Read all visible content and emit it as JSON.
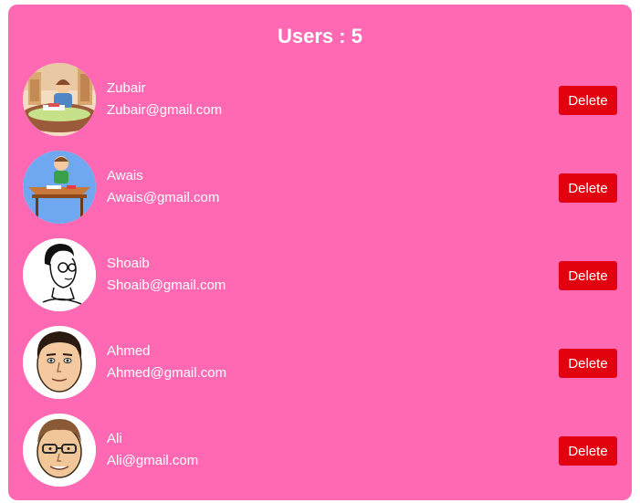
{
  "header": {
    "title": "Users : 5"
  },
  "users": [
    {
      "name": "Zubair",
      "email": "Zubair@gmail.com",
      "avatar_icon": "boy-reading-at-desk-avatar",
      "delete_label": "Delete"
    },
    {
      "name": "Awais",
      "email": "Awais@gmail.com",
      "avatar_icon": "boy-at-school-desk-avatar",
      "delete_label": "Delete"
    },
    {
      "name": "Shoaib",
      "email": "Shoaib@gmail.com",
      "avatar_icon": "sketched-man-with-glasses-avatar",
      "delete_label": "Delete"
    },
    {
      "name": "Ahmed",
      "email": "Ahmed@gmail.com",
      "avatar_icon": "cartoon-man-face-avatar",
      "delete_label": "Delete"
    },
    {
      "name": "Ali",
      "email": "Ali@gmail.com",
      "avatar_icon": "cartoon-man-with-glasses-avatar",
      "delete_label": "Delete"
    }
  ],
  "colors": {
    "card_background": "#ff69b4",
    "delete_button": "#e3000f",
    "text": "#ffffff"
  }
}
